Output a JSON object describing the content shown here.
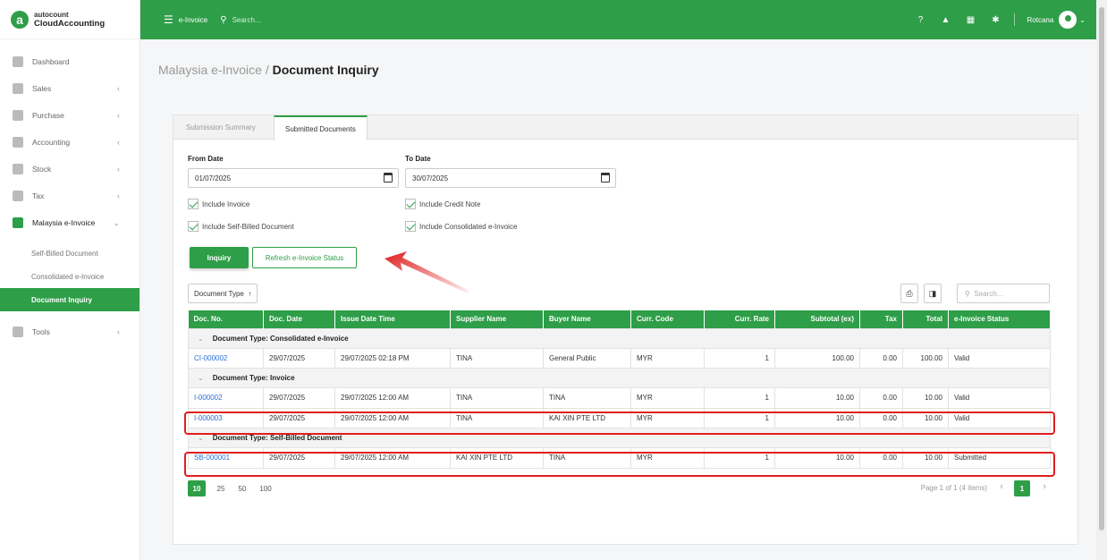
{
  "brand": {
    "small": "autocount",
    "name": "CloudAccounting",
    "mark": "a"
  },
  "sidebar": {
    "items": [
      {
        "label": "Dashboard",
        "chevron": ""
      },
      {
        "label": "Sales",
        "chevron": "‹"
      },
      {
        "label": "Purchase",
        "chevron": "‹"
      },
      {
        "label": "Accounting",
        "chevron": "‹"
      },
      {
        "label": "Stock",
        "chevron": "‹"
      },
      {
        "label": "Tax",
        "chevron": "‹"
      },
      {
        "label": "Malaysia e-Invoice",
        "chevron": "⌄"
      }
    ],
    "subitems": [
      "Self-Billed Document",
      "Consolidated e-Invoice",
      "Document Inquiry"
    ],
    "tools": {
      "label": "Tools",
      "chevron": "‹"
    }
  },
  "topbar": {
    "module": "e-Invoice",
    "search_placeholder": "Search...",
    "user": "Rotcana"
  },
  "page": {
    "breadcrumb_parent": "Malaysia e-Invoice / ",
    "title": "Document Inquiry"
  },
  "tabs": [
    "Submission Summary",
    "Submitted Documents"
  ],
  "filters": {
    "from_label": "From Date",
    "from_value": "01/07/2025",
    "to_label": "To Date",
    "to_value": "30/07/2025",
    "include_invoice": "Include Invoice",
    "include_credit_note": "Include Credit Note",
    "include_self_billed": "Include Self-Billed Document",
    "include_consolidated": "Include Consolidated e-Invoice"
  },
  "buttons": {
    "inquiry": "Inquiry",
    "refresh": "Refresh e-Invoice Status"
  },
  "grid": {
    "group_by": "Document Type",
    "sort_icon": "↑",
    "search_placeholder": "Search...",
    "columns": [
      "Doc. No.",
      "Doc. Date",
      "Issue Date Time",
      "Supplier Name",
      "Buyer Name",
      "Curr. Code",
      "Curr. Rate",
      "Subtotal (ex)",
      "Tax",
      "Total",
      "e-Invoice Status"
    ],
    "group_prefix": "Document Type: ",
    "groups": [
      {
        "name": "Consolidated e-Invoice",
        "rows": [
          [
            "CI-000002",
            "29/07/2025",
            "29/07/2025 02:18 PM",
            "TINA",
            "General Public",
            "MYR",
            "1",
            "100.00",
            "0.00",
            "100.00",
            "Valid"
          ]
        ]
      },
      {
        "name": "Invoice",
        "rows": [
          [
            "I-000002",
            "29/07/2025",
            "29/07/2025 12:00 AM",
            "TINA",
            "TINA",
            "MYR",
            "1",
            "10.00",
            "0.00",
            "10.00",
            "Valid"
          ],
          [
            "I-000003",
            "29/07/2025",
            "29/07/2025 12:00 AM",
            "TINA",
            "KAI XIN PTE LTD",
            "MYR",
            "1",
            "10.00",
            "0.00",
            "10.00",
            "Valid"
          ]
        ]
      },
      {
        "name": "Self-Billed Document",
        "rows": [
          [
            "SB-000001",
            "29/07/2025",
            "29/07/2025 12:00 AM",
            "KAI XIN PTE LTD",
            "TINA",
            "MYR",
            "1",
            "10.00",
            "0.00",
            "10.00",
            "Submitted"
          ]
        ]
      }
    ]
  },
  "pager": {
    "sizes": [
      "10",
      "25",
      "50",
      "100"
    ],
    "info": "Page 1 of 1 (4 items)",
    "current": "1",
    "prev": "‹",
    "next": "›"
  },
  "colors": {
    "accent": "#2e9e48",
    "highlight": "#e01e1e",
    "link": "#2a6fd6"
  }
}
